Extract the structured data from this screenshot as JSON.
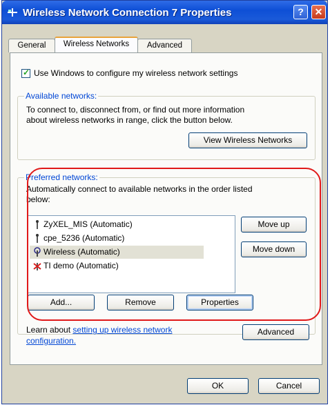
{
  "window": {
    "title": "Wireless Network Connection 7 Properties"
  },
  "titlebar": {
    "help_label": "?",
    "close_label": "✕"
  },
  "tabs": [
    {
      "label": "General",
      "active": false
    },
    {
      "label": "Wireless Networks",
      "active": true
    },
    {
      "label": "Advanced",
      "active": false
    }
  ],
  "use_windows_checkbox": {
    "label": "Use Windows to configure my wireless network settings",
    "checked": true
  },
  "available_networks": {
    "title": "Available networks:",
    "description_line1": "To connect to, disconnect from, or find out more information",
    "description_line2": "about wireless networks in range, click the button below.",
    "view_button": "View Wireless Networks"
  },
  "preferred_networks": {
    "title": "Preferred networks:",
    "description_line1": "Automatically connect to available networks in the order listed",
    "description_line2": "below:",
    "items": [
      {
        "label": "ZyXEL_MIS (Automatic)",
        "icon": "antenna-icon",
        "selected": false
      },
      {
        "label": "cpe_5236 (Automatic)",
        "icon": "antenna-icon",
        "selected": false
      },
      {
        "label": "Wireless (Automatic)",
        "icon": "connected-antenna-icon",
        "selected": true
      },
      {
        "label": "TI demo (Automatic)",
        "icon": "unavailable-antenna-icon",
        "selected": false
      }
    ],
    "move_up": "Move up",
    "move_down": "Move down",
    "add": "Add...",
    "remove": "Remove",
    "properties": "Properties"
  },
  "footer": {
    "learn_prefix": "Learn about ",
    "learn_link_line1": "setting up wireless network",
    "learn_link_line2": "configuration.",
    "advanced_button": "Advanced"
  },
  "dialog_buttons": {
    "ok": "OK",
    "cancel": "Cancel"
  },
  "colors": {
    "titlebar": "#0e4fd6",
    "group_title": "#0046d5",
    "highlight_outline": "#e01818"
  }
}
